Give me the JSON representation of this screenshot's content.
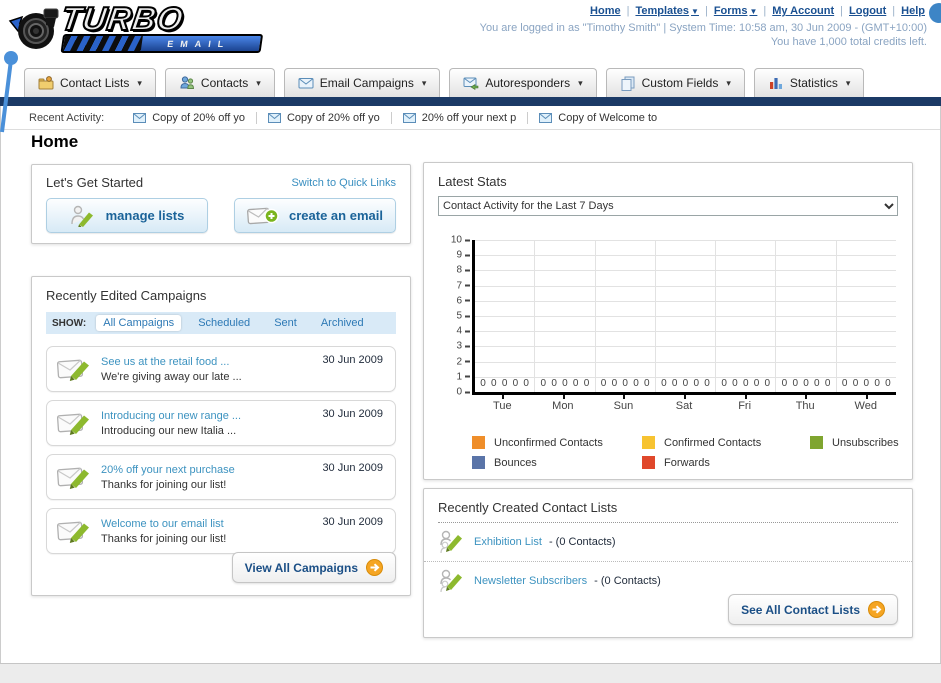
{
  "header": {
    "logo": {
      "title": "TURBO",
      "subtitle": "EMAIL"
    },
    "links": [
      {
        "label": "Home",
        "dropdown": false
      },
      {
        "label": "Templates",
        "dropdown": true
      },
      {
        "label": "Forms",
        "dropdown": true
      },
      {
        "label": "My Account",
        "dropdown": false
      },
      {
        "label": "Logout",
        "dropdown": false
      },
      {
        "label": "Help",
        "dropdown": false
      }
    ],
    "login_line1": "You are logged in as \"Timothy Smith\" | System Time: 10:58 am, 30 Jun 2009 - (GMT+10:00)",
    "login_line2": "You have 1,000 total credits left."
  },
  "nav": {
    "tabs": [
      {
        "label": "Contact Lists"
      },
      {
        "label": "Contacts"
      },
      {
        "label": "Email Campaigns"
      },
      {
        "label": "Autoresponders"
      },
      {
        "label": "Custom Fields"
      },
      {
        "label": "Statistics"
      }
    ],
    "arrow": "▾"
  },
  "recent_activity": {
    "label": "Recent Activity:",
    "items": [
      {
        "text": "Copy of 20% off yo"
      },
      {
        "text": "Copy of 20% off yo"
      },
      {
        "text": "20% off your next p"
      },
      {
        "text": "Copy of Welcome to"
      }
    ]
  },
  "page_title": "Home",
  "get_started": {
    "title": "Let's Get Started",
    "switch_link": "Switch to Quick Links",
    "buttons": [
      {
        "label": "manage lists"
      },
      {
        "label": "create an email"
      }
    ]
  },
  "campaigns": {
    "title": "Recently Edited Campaigns",
    "show_label": "SHOW:",
    "filters": [
      "All Campaigns",
      "Scheduled",
      "Sent",
      "Archived"
    ],
    "active_filter": "All Campaigns",
    "items": [
      {
        "title": "See us at the retail food ...",
        "subtitle": "We're giving away our late ...",
        "date": "30 Jun 2009"
      },
      {
        "title": "Introducing our new range ...",
        "subtitle": "Introducing our new Italia ...",
        "date": "30 Jun 2009"
      },
      {
        "title": "20% off your next purchase",
        "subtitle": "Thanks for joining our list!",
        "date": "30 Jun 2009"
      },
      {
        "title": "Welcome to our email list",
        "subtitle": "Thanks for joining our list!",
        "date": "30 Jun 2009"
      }
    ],
    "view_all_label": "View All Campaigns"
  },
  "stats": {
    "title": "Latest Stats",
    "selector_value": "Contact Activity for the Last 7 Days"
  },
  "chart_data": {
    "type": "bar",
    "title": "Contact Activity for the Last 7 Days",
    "categories": [
      "Tue",
      "Mon",
      "Sun",
      "Sat",
      "Fri",
      "Thu",
      "Wed"
    ],
    "series": [
      {
        "name": "Unconfirmed Contacts",
        "color": "#EF8E2A",
        "values": [
          0,
          0,
          0,
          0,
          0,
          0,
          0
        ]
      },
      {
        "name": "Confirmed Contacts",
        "color": "#F7C331",
        "values": [
          0,
          0,
          0,
          0,
          0,
          0,
          0
        ]
      },
      {
        "name": "Unsubscribes",
        "color": "#7FA52F",
        "values": [
          0,
          0,
          0,
          0,
          0,
          0,
          0
        ]
      },
      {
        "name": "Bounces",
        "color": "#5A74A8",
        "values": [
          0,
          0,
          0,
          0,
          0,
          0,
          0
        ]
      },
      {
        "name": "Forwards",
        "color": "#E0482B",
        "values": [
          0,
          0,
          0,
          0,
          0,
          0,
          0
        ]
      }
    ],
    "xlabel": "",
    "ylabel": "",
    "ylim": [
      0,
      10
    ],
    "ytick_step": 1,
    "grid": true,
    "legend_position": "bottom"
  },
  "contact_lists": {
    "title": "Recently Created Contact Lists",
    "items": [
      {
        "name": "Exhibition List",
        "count_text": "- (0 Contacts)"
      },
      {
        "name": "Newsletter Subscribers",
        "count_text": "- (0 Contacts)"
      }
    ],
    "see_all_label": "See All Contact Lists"
  },
  "colors": {
    "navy_bar": "#1b3a66",
    "header_link": "#1a5091",
    "muted_login_text": "#8aa4c2",
    "teal_link": "#3d93c0",
    "show_bar_bg": "#d9eaf7",
    "button_text_blue": "#1b6399",
    "orange_arrow": "#f5a523",
    "pin_blue": "#4a90d9"
  }
}
